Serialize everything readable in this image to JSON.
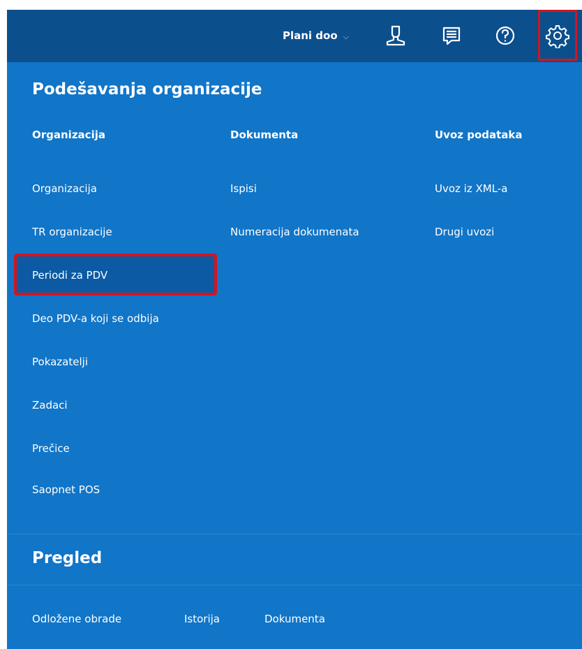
{
  "topbar": {
    "company_name": "Plani doo",
    "company_chevron": "⌵",
    "icons": [
      "user-icon",
      "messages-icon",
      "help-icon",
      "settings-icon"
    ]
  },
  "settings": {
    "title": "Podešavanja organizacije",
    "columns": [
      {
        "heading": "Organizacija",
        "items": [
          "Organizacija",
          "TR organizacije",
          "Periodi za PDV",
          "Deo PDV-a koji se odbija",
          "Pokazatelji",
          "Zadaci",
          "Prečice",
          "Saopnet POS"
        ]
      },
      {
        "heading": "Dokumenta",
        "items": [
          "Ispisi",
          "Numeracija dokumenata"
        ]
      },
      {
        "heading": "Uvoz podataka",
        "items": [
          "Uvoz iz XML-a",
          "Drugi uvozi"
        ]
      }
    ]
  },
  "overview": {
    "title": "Pregled",
    "links": [
      "Odložene obrade",
      "Istorija",
      "Dokumenta"
    ]
  },
  "colors": {
    "topbar": "#0c4f8d",
    "panel": "#1175c8",
    "highlight_border": "#d4151f"
  }
}
